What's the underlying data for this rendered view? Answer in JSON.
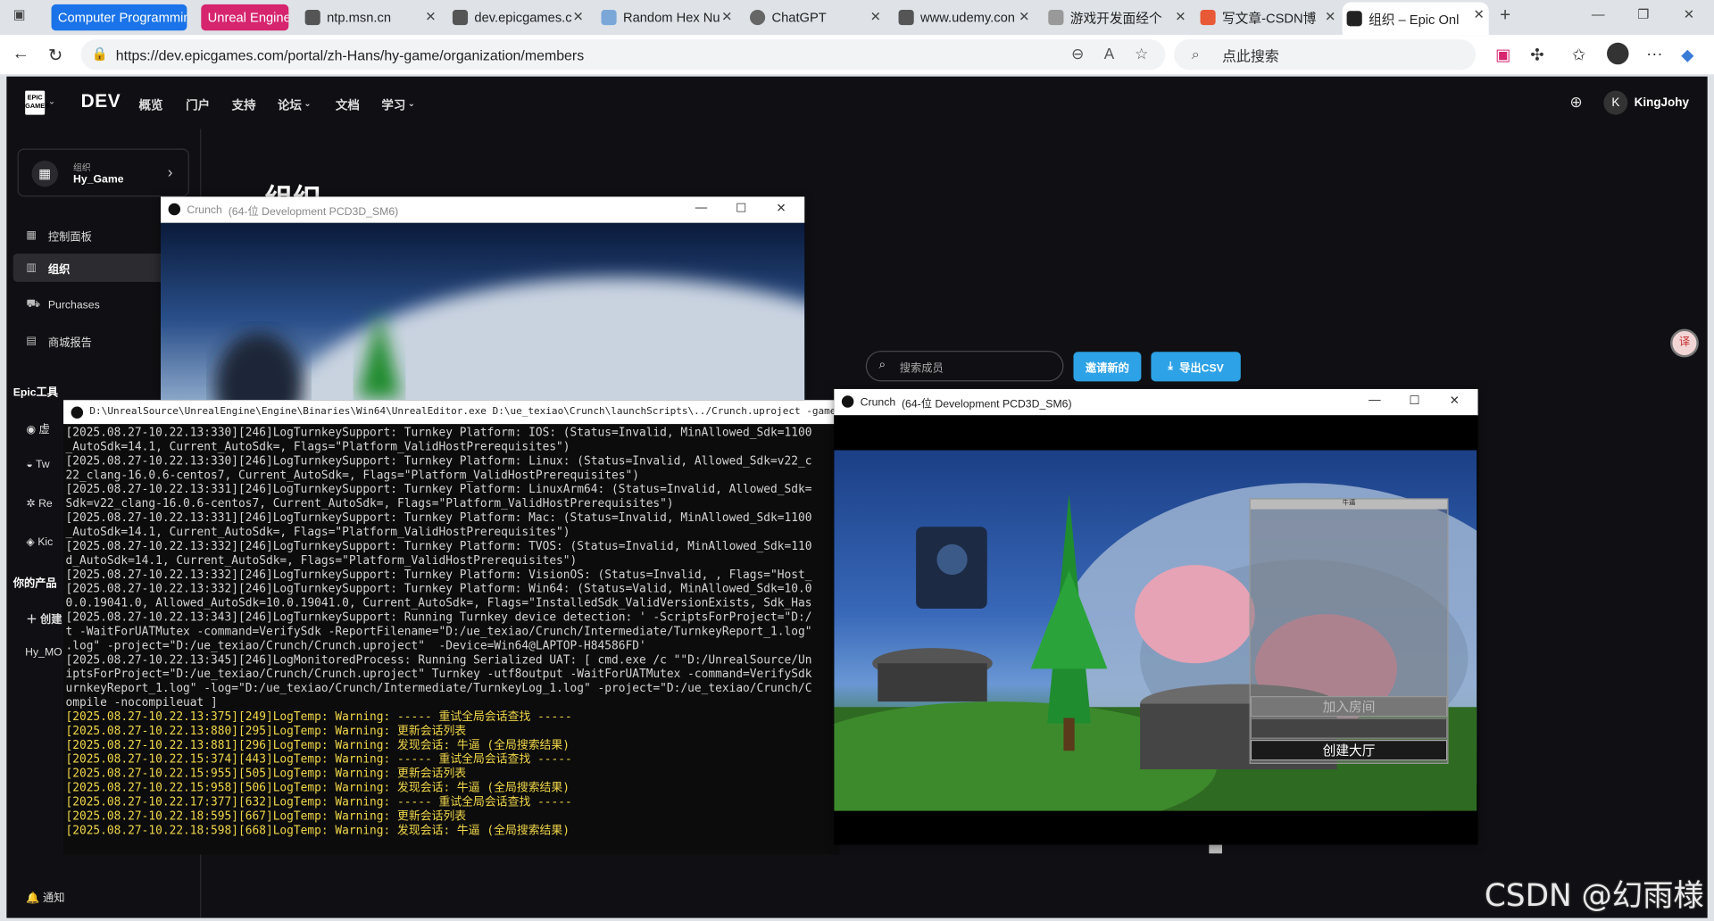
{
  "browser": {
    "tabs": [
      {
        "label": "Computer Programmin",
        "color": "#1a73e8"
      },
      {
        "label": "Unreal Engine",
        "color": "#d6246e"
      },
      {
        "label": "ntp.msn.cn"
      },
      {
        "label": "dev.epicgames.c"
      },
      {
        "label": "Random Hex Nu"
      },
      {
        "label": "ChatGPT"
      },
      {
        "label": "www.udemy.con"
      },
      {
        "label": "游戏开发面经个"
      },
      {
        "label": "写文章-CSDN博"
      },
      {
        "label": "组织 – Epic Onl"
      }
    ],
    "url": "https://dev.epicgames.com/portal/zh-Hans/hy-game/organization/members",
    "search_placeholder": "点此搜索"
  },
  "epic": {
    "brand": "DEV",
    "logo_text": "EPIC GAMES",
    "nav": [
      "概览",
      "门户",
      "支持",
      "论坛",
      "文档",
      "学习"
    ],
    "user_initial": "K",
    "username": "KingJohy",
    "org": {
      "label": "组织",
      "name": "Hy_Game"
    },
    "sidebar": [
      {
        "label": "控制面板",
        "icon": "grid-icon"
      },
      {
        "label": "组织",
        "icon": "building-icon"
      },
      {
        "label": "Purchases",
        "icon": "cart-icon"
      },
      {
        "label": "商城报告",
        "icon": "report-icon"
      }
    ],
    "epic_tools_header": "Epic工具",
    "tools": [
      "虚",
      "Tw",
      "Re",
      "Kic"
    ],
    "products_header": "你的产品",
    "create_label": "创建",
    "product_item": "Hy_MO",
    "notifications": "通知",
    "page_title": "组织",
    "member_search_placeholder": "搜索成员",
    "invite_label": "邀请新的",
    "export_label": "导出CSV"
  },
  "game_window_1": {
    "title": "Crunch",
    "subtitle": "(64-位 Development PCD3D_SM6)"
  },
  "console": {
    "title": "D:\\UnrealSource\\UnrealEngine\\Engine\\Binaries\\Win64\\UnrealEditor.exe  D:\\ue_texiao\\Crunch\\launchScripts\\../Crunch.uproject -game -log -epicapp=\"GameCli",
    "lines": [
      {
        "t": "[2025.08.27-10.22.13:330][246]LogTurnkeySupport: Turnkey Platform: IOS: (Status=Invalid, MinAllowed_Sdk=1100",
        "w": false
      },
      {
        "t": "_AutoSdk=14.1, Current_AutoSdk=, Flags=\"Platform_ValidHostPrerequisites\")",
        "w": false
      },
      {
        "t": "[2025.08.27-10.22.13:330][246]LogTurnkeySupport: Turnkey Platform: Linux: (Status=Invalid, Allowed_Sdk=v22_c",
        "w": false
      },
      {
        "t": "22_clang-16.0.6-centos7, Current_AutoSdk=, Flags=\"Platform_ValidHostPrerequisites\")",
        "w": false
      },
      {
        "t": "[2025.08.27-10.22.13:331][246]LogTurnkeySupport: Turnkey Platform: LinuxArm64: (Status=Invalid, Allowed_Sdk=",
        "w": false
      },
      {
        "t": "Sdk=v22_clang-16.0.6-centos7, Current_AutoSdk=, Flags=\"Platform_ValidHostPrerequisites\")",
        "w": false
      },
      {
        "t": "[2025.08.27-10.22.13:331][246]LogTurnkeySupport: Turnkey Platform: Mac: (Status=Invalid, MinAllowed_Sdk=1100",
        "w": false
      },
      {
        "t": "_AutoSdk=14.1, Current_AutoSdk=, Flags=\"Platform_ValidHostPrerequisites\")",
        "w": false
      },
      {
        "t": "[2025.08.27-10.22.13:332][246]LogTurnkeySupport: Turnkey Platform: TVOS: (Status=Invalid, MinAllowed_Sdk=110",
        "w": false
      },
      {
        "t": "d_AutoSdk=14.1, Current_AutoSdk=, Flags=\"Platform_ValidHostPrerequisites\")",
        "w": false
      },
      {
        "t": "[2025.08.27-10.22.13:332][246]LogTurnkeySupport: Turnkey Platform: VisionOS: (Status=Invalid, , Flags=\"Host_",
        "w": false
      },
      {
        "t": "[2025.08.27-10.22.13:332][246]LogTurnkeySupport: Turnkey Platform: Win64: (Status=Valid, MinAllowed_Sdk=10.0",
        "w": false
      },
      {
        "t": "0.0.19041.0, Allowed_AutoSdk=10.0.19041.0, Current_AutoSdk=, Flags=\"InstalledSdk_ValidVersionExists, Sdk_Has",
        "w": false
      },
      {
        "t": "[2025.08.27-10.22.13:343][246]LogTurnkeySupport: Running Turnkey device detection: ' -ScriptsForProject=\"D:/",
        "w": false
      },
      {
        "t": "t -WaitForUATMutex -command=VerifySdk -ReportFilename=\"D:/ue_texiao/Crunch/Intermediate/TurnkeyReport_1.log\"",
        "w": false
      },
      {
        "t": ".log\" -project=\"D:/ue_texiao/Crunch/Crunch.uproject\"  -Device=Win64@LAPTOP-H84586FD'",
        "w": false
      },
      {
        "t": "[2025.08.27-10.22.13:345][246]LogMonitoredProcess: Running Serialized UAT: [ cmd.exe /c \"\"D:/UnrealSource/Un",
        "w": false
      },
      {
        "t": "iptsForProject=\"D:/ue_texiao/Crunch/Crunch.uproject\" Turnkey -utf8output -WaitForUATMutex -command=VerifySdk",
        "w": false
      },
      {
        "t": "urnkeyReport_1.log\" -log=\"D:/ue_texiao/Crunch/Intermediate/TurnkeyLog_1.log\" -project=\"D:/ue_texiao/Crunch/C",
        "w": false
      },
      {
        "t": "ompile -nocompileuat ]",
        "w": false
      },
      {
        "t": "[2025.08.27-10.22.13:375][249]LogTemp: Warning: ----- 重试全局会话查找 -----",
        "w": true
      },
      {
        "t": "[2025.08.27-10.22.13:880][295]LogTemp: Warning: 更新会话列表",
        "w": true
      },
      {
        "t": "[2025.08.27-10.22.13:881][296]LogTemp: Warning: 发现会话: 牛逼 (全局搜索结果)",
        "w": true
      },
      {
        "t": "[2025.08.27-10.22.15:374][443]LogTemp: Warning: ----- 重试全局会话查找 -----",
        "w": true
      },
      {
        "t": "[2025.08.27-10.22.15:955][505]LogTemp: Warning: 更新会话列表",
        "w": true
      },
      {
        "t": "[2025.08.27-10.22.15:958][506]LogTemp: Warning: 发现会话: 牛逼 (全局搜索结果)",
        "w": true
      },
      {
        "t": "[2025.08.27-10.22.17:377][632]LogTemp: Warning: ----- 重试全局会话查找 -----",
        "w": true
      },
      {
        "t": "[2025.08.27-10.22.18:595][667]LogTemp: Warning: 更新会话列表",
        "w": true
      },
      {
        "t": "[2025.08.27-10.22.18:598][668]LogTemp: Warning: 发现会话: 牛逼 (全局搜索结果)",
        "w": true
      }
    ]
  },
  "game_window_2": {
    "title": "Crunch",
    "subtitle": "(64-位 Development PCD3D_SM6)",
    "panel_title": "牛逼",
    "join_label": "加入房间",
    "create_label": "创建大厅"
  },
  "watermark": "CSDN @幻雨様"
}
